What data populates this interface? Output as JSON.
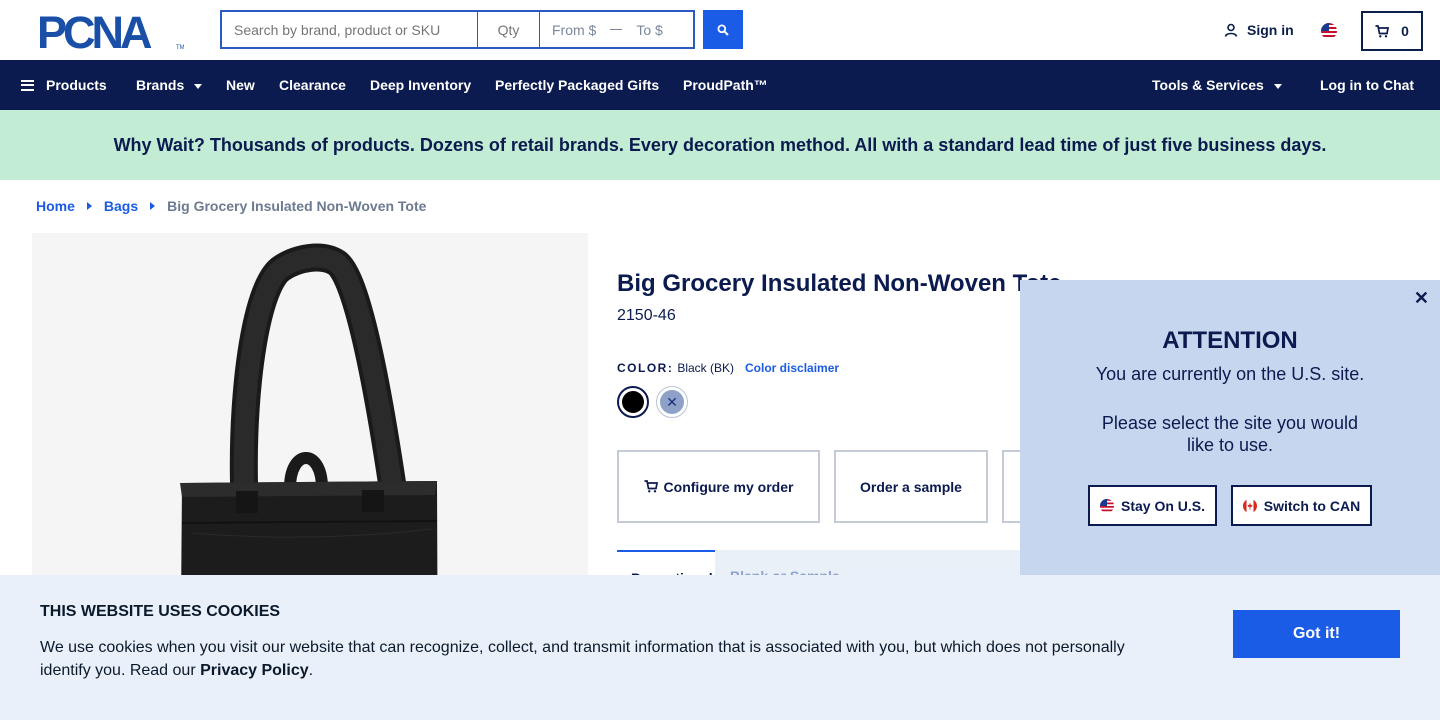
{
  "header": {
    "logo_text": "PCNA",
    "search_placeholder": "Search by brand, product or SKU",
    "qty_placeholder": "Qty",
    "from_placeholder": "From $",
    "to_placeholder": "To $",
    "signin_label": "Sign in",
    "cart_count": "0"
  },
  "nav": {
    "items": [
      {
        "label": "Products"
      },
      {
        "label": "Brands"
      },
      {
        "label": "New"
      },
      {
        "label": "Clearance"
      },
      {
        "label": "Deep Inventory"
      },
      {
        "label": "Perfectly Packaged Gifts"
      },
      {
        "label": "ProudPath™"
      }
    ],
    "tools_label": "Tools & Services",
    "chat_label": "Log in to Chat"
  },
  "promo": {
    "text": "Why Wait? Thousands of products. Dozens of retail brands. Every decoration method. All with a standard lead time of just five business days."
  },
  "breadcrumb": {
    "home": "Home",
    "category": "Bags",
    "current": "Big Grocery Insulated Non-Woven Tote"
  },
  "product": {
    "title": "Big Grocery Insulated Non-Woven Tote",
    "sku": "2150-46",
    "color_label": "COLOR:",
    "color_value": "Black (BK)",
    "color_disclaimer": "Color disclaimer",
    "swatches": [
      {
        "name": "Black",
        "hex": "#000000"
      },
      {
        "name": "Royal",
        "hex": "#8ea2c9"
      }
    ],
    "actions": {
      "configure": "Configure my order",
      "sample": "Order a sample"
    },
    "tabs": {
      "active": "Promotional",
      "second": "Blank or Sample"
    }
  },
  "popup": {
    "title": "ATTENTION",
    "line1": "You are currently on the U.S. site.",
    "line2": "Please select the site you would like to use.",
    "stay_label": "Stay On U.S.",
    "switch_label": "Switch to CAN"
  },
  "cookie": {
    "title": "THIS WEBSITE USES COOKIES",
    "text": "We use cookies when you visit our website that can recognize, collect, and transmit information that is associated with you, but which does not personally identify you. Read our ",
    "link": "Privacy Policy",
    "end": ".",
    "button": "Got it!"
  },
  "colors": {
    "navy": "#0b1a4f",
    "accent_blue": "#1a5ce6",
    "promo_green": "#c3ecd4",
    "popup_bg": "#c6d6ee",
    "cookie_bg": "#e9f0fa"
  }
}
